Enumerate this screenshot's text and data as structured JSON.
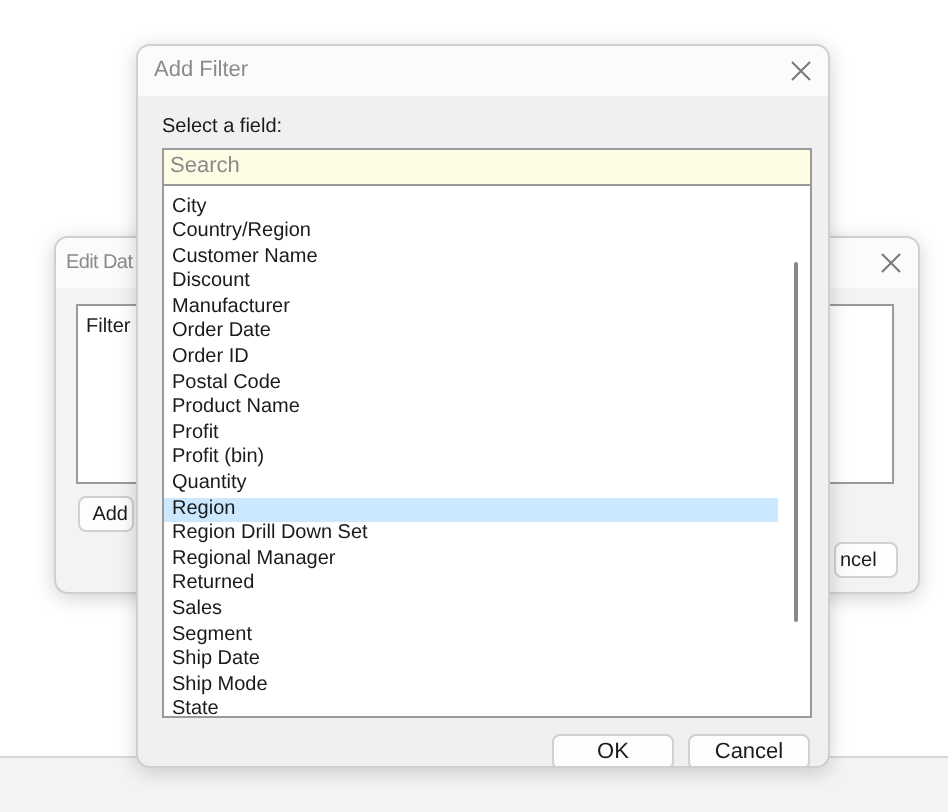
{
  "background_dialog": {
    "title": "Edit Dat",
    "list_header": "Filter",
    "buttons": [
      "Add",
      "ncel"
    ]
  },
  "dialog": {
    "title": "Add Filter",
    "prompt": "Select a field:",
    "search": {
      "placeholder": "Search"
    },
    "fields": [
      {
        "label": "City",
        "selected": false
      },
      {
        "label": "Country/Region",
        "selected": false
      },
      {
        "label": "Customer Name",
        "selected": false
      },
      {
        "label": "Discount",
        "selected": false
      },
      {
        "label": "Manufacturer",
        "selected": false
      },
      {
        "label": "Order Date",
        "selected": false
      },
      {
        "label": "Order ID",
        "selected": false
      },
      {
        "label": "Postal Code",
        "selected": false
      },
      {
        "label": "Product Name",
        "selected": false
      },
      {
        "label": "Profit",
        "selected": false
      },
      {
        "label": "Profit (bin)",
        "selected": false
      },
      {
        "label": "Quantity",
        "selected": false
      },
      {
        "label": "Region",
        "selected": true
      },
      {
        "label": "Region Drill Down Set",
        "selected": false
      },
      {
        "label": "Regional Manager",
        "selected": false
      },
      {
        "label": "Returned",
        "selected": false
      },
      {
        "label": "Sales",
        "selected": false
      },
      {
        "label": "Segment",
        "selected": false
      },
      {
        "label": "Ship Date",
        "selected": false
      },
      {
        "label": "Ship Mode",
        "selected": false
      },
      {
        "label": "State",
        "selected": false
      }
    ],
    "buttons": [
      "OK",
      "Cancel"
    ]
  }
}
